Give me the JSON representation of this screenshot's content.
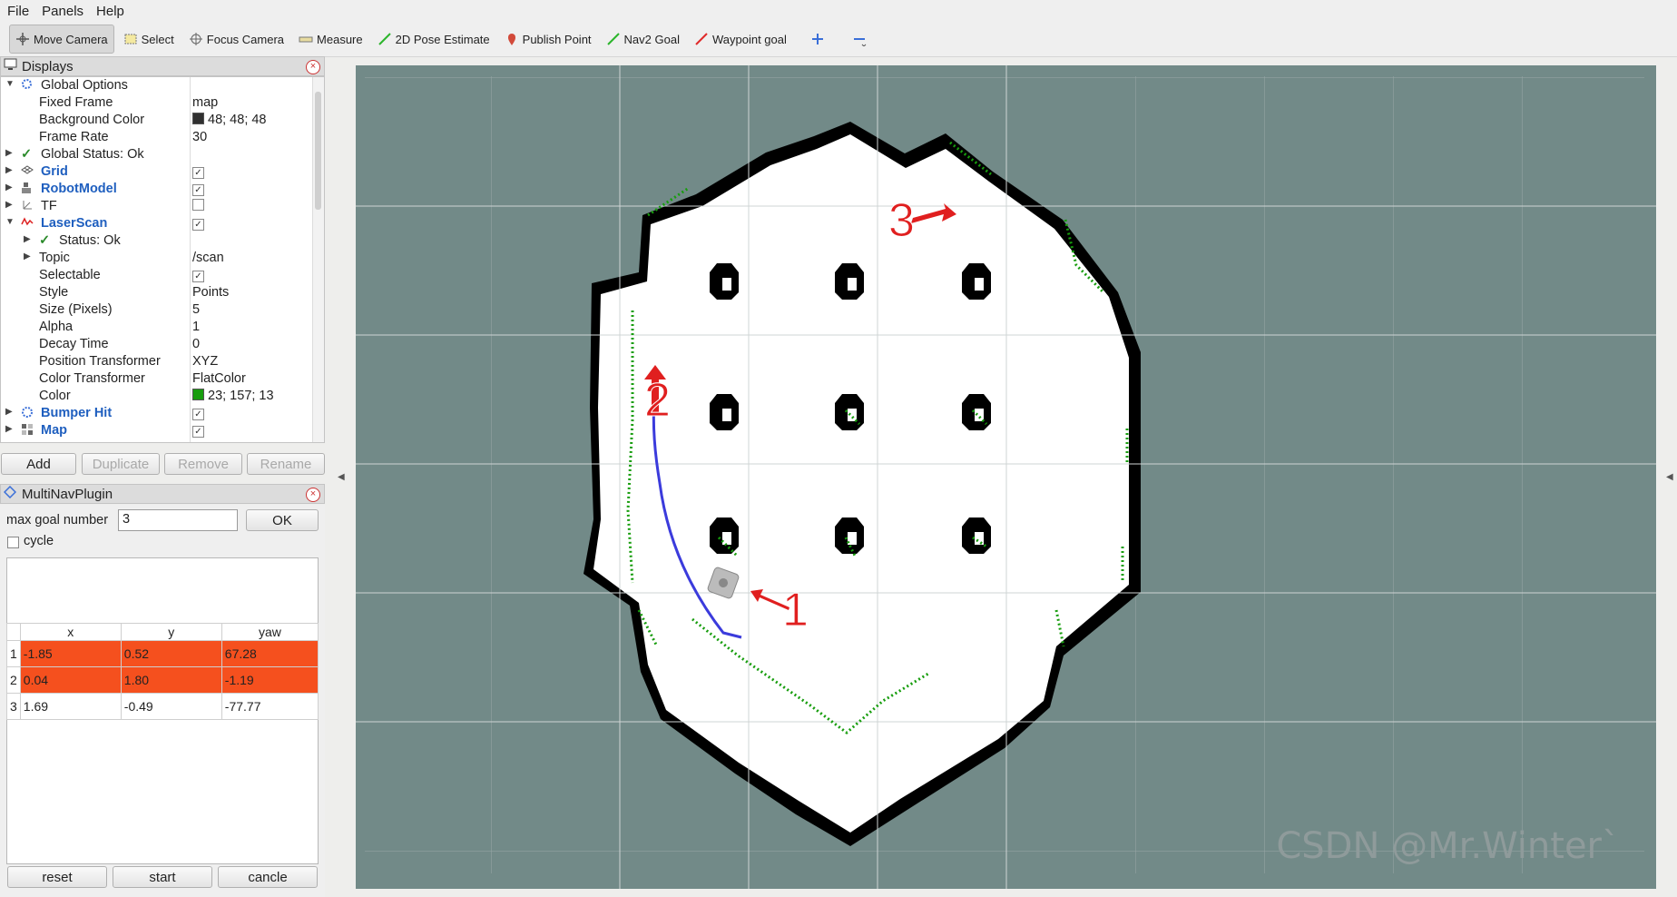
{
  "menu": [
    "File",
    "Panels",
    "Help"
  ],
  "toolbar": {
    "tools": [
      {
        "label": "Move Camera",
        "icon": "move-camera-icon"
      },
      {
        "label": "Select",
        "icon": "select-icon"
      },
      {
        "label": "Focus Camera",
        "icon": "focus-camera-icon"
      },
      {
        "label": "Measure",
        "icon": "measure-icon"
      },
      {
        "label": "2D Pose Estimate",
        "icon": "pose-estimate-icon"
      },
      {
        "label": "Publish Point",
        "icon": "publish-point-icon"
      },
      {
        "label": "Nav2 Goal",
        "icon": "nav2-goal-icon"
      },
      {
        "label": "Waypoint goal",
        "icon": "waypoint-goal-icon"
      }
    ]
  },
  "displays": {
    "title": "Displays",
    "rows": [
      {
        "label": "Global Options",
        "value": ""
      },
      {
        "label": "Fixed Frame",
        "value": "map"
      },
      {
        "label": "Background Color",
        "value": "48; 48; 48",
        "swatch": "#303030"
      },
      {
        "label": "Frame Rate",
        "value": "30"
      },
      {
        "label": "Global Status: Ok",
        "value": ""
      },
      {
        "label": "Grid",
        "value": ""
      },
      {
        "label": "RobotModel",
        "value": ""
      },
      {
        "label": "TF",
        "value": ""
      },
      {
        "label": "LaserScan",
        "value": ""
      },
      {
        "label": "Status: Ok",
        "value": ""
      },
      {
        "label": "Topic",
        "value": "/scan"
      },
      {
        "label": "Selectable",
        "value": ""
      },
      {
        "label": "Style",
        "value": "Points"
      },
      {
        "label": "Size (Pixels)",
        "value": "5"
      },
      {
        "label": "Alpha",
        "value": "1"
      },
      {
        "label": "Decay Time",
        "value": "0"
      },
      {
        "label": "Position Transformer",
        "value": "XYZ"
      },
      {
        "label": "Color Transformer",
        "value": "FlatColor"
      },
      {
        "label": "Color",
        "value": "23; 157; 13",
        "swatch": "#179d0d"
      },
      {
        "label": "Bumper Hit",
        "value": ""
      },
      {
        "label": "Map",
        "value": ""
      }
    ],
    "buttons": [
      "Add",
      "Duplicate",
      "Remove",
      "Rename"
    ]
  },
  "multinav": {
    "title": "MultiNavPlugin",
    "max_goal_label": "max goal number",
    "max_goal_value": "3",
    "ok": "OK",
    "cycle": "cycle",
    "columns": [
      "x",
      "y",
      "yaw"
    ],
    "goals": [
      {
        "idx": "1",
        "x": "-1.85",
        "y": "0.52",
        "yaw": "67.28",
        "highlight": true
      },
      {
        "idx": "2",
        "x": "0.04",
        "y": "1.80",
        "yaw": "-1.19",
        "highlight": true
      },
      {
        "idx": "3",
        "x": "1.69",
        "y": "-0.49",
        "yaw": "-77.77",
        "highlight": false
      }
    ],
    "buttons": [
      "reset",
      "start",
      "cancle"
    ]
  },
  "view": {
    "background": "#728a88",
    "laser_color": "#179d0d",
    "path_color": "#3b3bdc",
    "markers": [
      "1",
      "2",
      "3"
    ],
    "watermark": "CSDN @Mr.Winter`"
  }
}
